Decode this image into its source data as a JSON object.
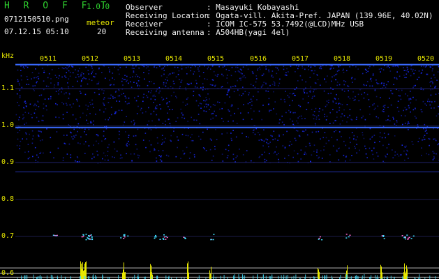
{
  "header": {
    "app_title": "H R O F F T",
    "app_version": "1.0.0",
    "filename": "0712150510.png",
    "datetime": "07.12.15 05:10",
    "meteor_label": "meteor",
    "meteor_count": "20",
    "info": [
      {
        "label": "Observer",
        "value": ": Masayuki Kobayashi"
      },
      {
        "label": "Receiving Location",
        "value": ": Ogata-vill. Akita-Pref. JAPAN (139.96E, 40.02N)"
      },
      {
        "label": "Receiver",
        "value": ": ICOM IC-575 53.7492(@LCD)MHz USB"
      },
      {
        "label": "Receiving antenna",
        "value": ": A504HB(yagi 4el)"
      }
    ]
  },
  "colors": {
    "accent_green": "#2fd02f",
    "label_yellow": "#e8e800",
    "noise_blue": "#1a2cff",
    "meteor_cyan": "#40e0ff"
  },
  "chart_data": {
    "type": "heatmap",
    "ylabel": "kHz",
    "y_ticks": [
      "1.1",
      "1.0",
      "0.9",
      "0.8",
      "0.7",
      "0.6"
    ],
    "y_tick_values": [
      1.1,
      1.0,
      0.9,
      0.8,
      0.7,
      0.6
    ],
    "x_ticks": [
      "0511",
      "0512",
      "0513",
      "0514",
      "0515",
      "0516",
      "0517",
      "0518",
      "0519",
      "0520"
    ],
    "ylim": [
      0.585,
      1.17
    ],
    "noise_band": [
      0.9,
      1.165
    ],
    "carrier_lines": [
      1.165,
      1.1,
      0.995,
      0.9,
      0.875
    ],
    "meteor_echo_band": 0.7,
    "grid": true
  }
}
